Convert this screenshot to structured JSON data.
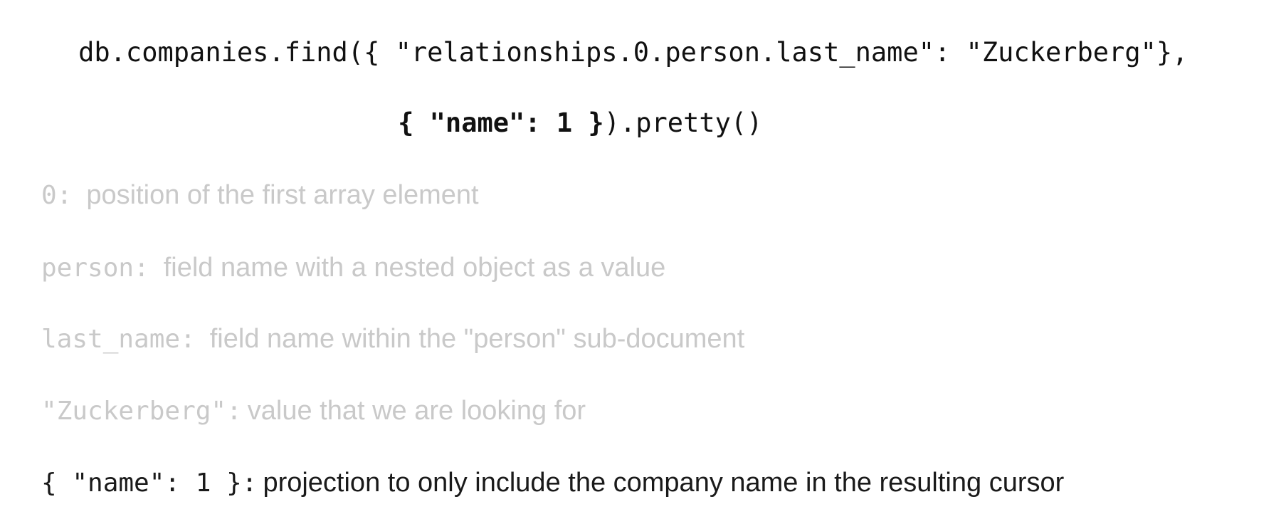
{
  "code": {
    "line1": "db.companies.find({ \"relationships.0.person.last_name\": \"Zuckerberg\"},",
    "line2_bold": "{ \"name\": 1 }",
    "line2_rest": ").pretty()"
  },
  "notes": [
    {
      "key": "0:",
      "desc": "position of the first array element"
    },
    {
      "key": "person:",
      "desc": "field name with a nested object as a value"
    },
    {
      "key": "last_name:",
      "desc": "field name within the \"person\" sub-document"
    },
    {
      "key": "\"Zuckerberg\":",
      "desc": "value that we are looking for"
    },
    {
      "key": "{ \"name\": 1 }:",
      "desc": "projection to only include the company name in the resulting cursor"
    }
  ],
  "colors": {
    "text": "#111111",
    "faded": "#c9c9c9",
    "background": "#ffffff"
  }
}
